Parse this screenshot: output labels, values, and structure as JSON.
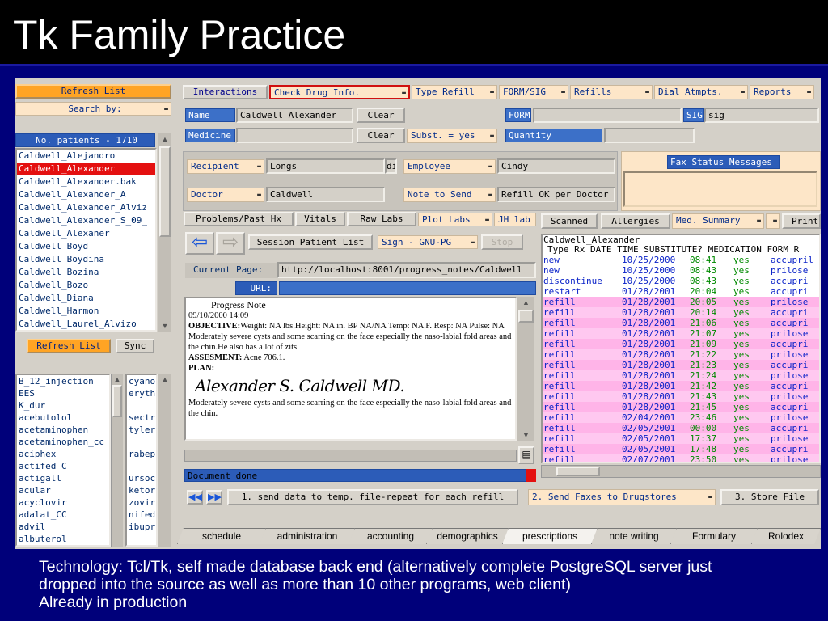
{
  "slide": {
    "title": "Tk Family Practice",
    "caption_lines": [
      "Technology: Tcl/Tk, self made database back end (alternatively complete PostgreSQL server just",
      "dropped into the source as well as more than 10 other programs, web client)",
      "Already in production"
    ]
  },
  "left": {
    "refresh_top": "Refresh List",
    "search_by": "Search by:",
    "patients_header": "No. patients - 1710",
    "patients": [
      "Caldwell_Alejandro",
      "Caldwell_Alexander",
      "Caldwell_Alexander.bak",
      "Caldwell_Alexander_A",
      "Caldwell_Alexander_Alviz",
      "Caldwell_Alexander_S_09_",
      "Caldwell_Alexaner",
      "Caldwell_Boyd",
      "Caldwell_Boydina",
      "Caldwell_Bozina",
      "Caldwell_Bozo",
      "Caldwell_Diana",
      "Caldwell_Harmon",
      "Caldwell_Laurel_Alvizo"
    ],
    "refresh_bottom": "Refresh List",
    "sync": "Sync",
    "drugs": [
      "B_12_injection",
      "EES",
      "K_dur",
      "acebutolol",
      "acetaminophen",
      "acetaminophen_cc",
      "aciphex",
      "actifed_C",
      "actigall",
      "acular",
      "acyclovir",
      "adalat_CC",
      "advil",
      "albuterol"
    ],
    "drugs2": [
      "cyano",
      "eryth",
      "",
      "sectr",
      "tyler",
      "",
      "rabep",
      "",
      "ursoc",
      "ketor",
      "zovir",
      "nifed",
      "ibupr",
      ""
    ]
  },
  "toolbar": {
    "interactions": "Interactions",
    "check_drug": "Check Drug Info.",
    "type_refill": "Type Refill",
    "form_sig": "FORM/SIG",
    "refills": "Refills",
    "dial": "Dial Atmpts.",
    "reports": "Reports"
  },
  "form": {
    "name_label": "Name",
    "name_value": "Caldwell_Alexander",
    "clear1": "Clear",
    "medicine_label": "Medicine",
    "clear2": "Clear",
    "subst": "Subst. = yes",
    "form_label": "FORM",
    "sig_label": "SIG",
    "sig_value": "sig",
    "quantity_label": "Quantity",
    "recipient_label": "Recipient",
    "recipient_value": "Longs",
    "di": "di",
    "employee_label": "Employee",
    "employee_value": "Cindy",
    "doctor_label": "Doctor",
    "doctor_value": "Caldwell",
    "note_label": "Note to Send",
    "note_value": "Refill OK per Doctor",
    "fax_status": "Fax Status Messages"
  },
  "browser": {
    "tabs": [
      "Problems/Past Hx",
      "Vitals",
      "Raw Labs",
      "Plot Labs",
      "JH lab"
    ],
    "session_list": "Session Patient List",
    "sign": "Sign - GNU-PG",
    "stop": "Stop",
    "current_page_label": "Current Page:",
    "current_page_value": "http://localhost:8001/progress_notes/Caldwell",
    "url_label": "URL:",
    "status": "Document done",
    "doc_title": "Progress Note",
    "doc_date": "09/10/2000 14:09",
    "objective_label": "OBJECTIVE:",
    "objective_text": "Weight: NA lbs.Height: NA in. BP NA/NA Temp: NA F. Resp: NA Pulse: NA",
    "note1": "Moderately severe cysts and some scarring on the face especially the naso-labial fold areas and the chin.He also has a lot of zits.",
    "assesment_label": "ASSESMENT:",
    "assesment_text": "Acne 706.1.",
    "plan_label": "PLAN:",
    "signature": "Alexander S. Caldwell MD.",
    "note2": "Moderately severe cysts and some scarring on the face especially the naso-labial fold areas and the chin."
  },
  "meds": {
    "tabs": [
      "Scanned",
      "Allergies",
      "Med. Summary",
      "Print"
    ],
    "patient": "Caldwell_Alexander",
    "header": "Type Rx DATE TIME SUBSTITUTE? MEDICATION FORM R",
    "rows": [
      {
        "type": "new",
        "date": "10/25/2000",
        "time": "08:41",
        "subst": "yes",
        "med": "accupril"
      },
      {
        "type": "new",
        "date": "10/25/2000",
        "time": "08:43",
        "subst": "yes",
        "med": "prilose"
      },
      {
        "type": "discontinue",
        "date": "10/25/2000",
        "time": "08:43",
        "subst": "yes",
        "med": "accupri"
      },
      {
        "type": "restart",
        "date": "01/28/2001",
        "time": "20:04",
        "subst": "yes",
        "med": "accupri"
      },
      {
        "type": "refill",
        "date": "01/28/2001",
        "time": "20:05",
        "subst": "yes",
        "med": "prilose"
      },
      {
        "type": "refill",
        "date": "01/28/2001",
        "time": "20:14",
        "subst": "yes",
        "med": "accupri"
      },
      {
        "type": "refill",
        "date": "01/28/2001",
        "time": "21:06",
        "subst": "yes",
        "med": "accupri"
      },
      {
        "type": "refill",
        "date": "01/28/2001",
        "time": "21:07",
        "subst": "yes",
        "med": "prilose"
      },
      {
        "type": "refill",
        "date": "01/28/2001",
        "time": "21:09",
        "subst": "yes",
        "med": "accupri"
      },
      {
        "type": "refill",
        "date": "01/28/2001",
        "time": "21:22",
        "subst": "yes",
        "med": "prilose"
      },
      {
        "type": "refill",
        "date": "01/28/2001",
        "time": "21:23",
        "subst": "yes",
        "med": "accupri"
      },
      {
        "type": "refill",
        "date": "01/28/2001",
        "time": "21:24",
        "subst": "yes",
        "med": "prilose"
      },
      {
        "type": "refill",
        "date": "01/28/2001",
        "time": "21:42",
        "subst": "yes",
        "med": "accupri"
      },
      {
        "type": "refill",
        "date": "01/28/2001",
        "time": "21:43",
        "subst": "yes",
        "med": "prilose"
      },
      {
        "type": "refill",
        "date": "01/28/2001",
        "time": "21:45",
        "subst": "yes",
        "med": "accupri"
      },
      {
        "type": "refill",
        "date": "02/04/2001",
        "time": "23:46",
        "subst": "yes",
        "med": "prilose"
      },
      {
        "type": "refill",
        "date": "02/05/2001",
        "time": "00:00",
        "subst": "yes",
        "med": "accupri"
      },
      {
        "type": "refill",
        "date": "02/05/2001",
        "time": "17:37",
        "subst": "yes",
        "med": "prilose"
      },
      {
        "type": "refill",
        "date": "02/05/2001",
        "time": "17:48",
        "subst": "yes",
        "med": "accupri"
      },
      {
        "type": "refill",
        "date": "02/07/2001",
        "time": "23:50",
        "subst": "yes",
        "med": "prilose"
      }
    ]
  },
  "actions": {
    "send_data": "1. send data to temp. file-repeat for each refill",
    "send_faxes": "2. Send Faxes to Drugstores",
    "store_file": "3. Store File"
  },
  "bottom_tabs": [
    "schedule",
    "administration",
    "accounting",
    "demographics",
    "prescriptions",
    "note writing",
    "Formulary",
    "Rolodex"
  ],
  "colors": {
    "row_pink": "#ffb4e8",
    "row_white": "#ffffff",
    "time_green": "#008a00",
    "accent_orange": "#ffa424"
  }
}
